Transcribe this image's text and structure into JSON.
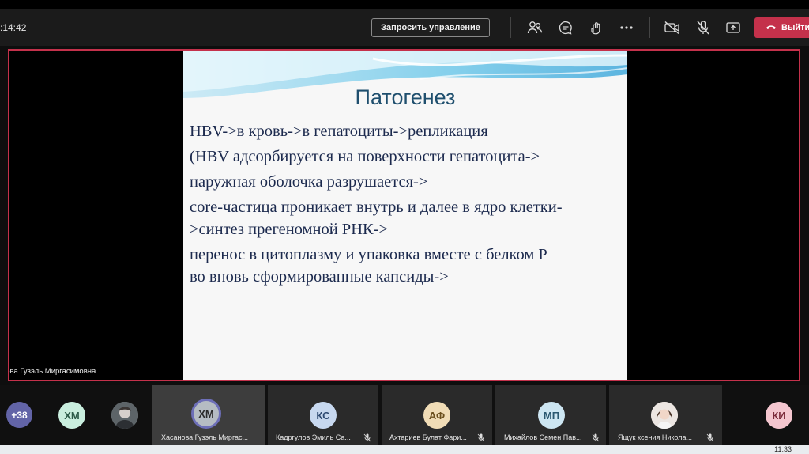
{
  "meeting": {
    "timer": ":14:42",
    "request_control_label": "Запросить управление",
    "leave_label": "Выйти",
    "presenter_name": "нова Гузэль Миргасимовна"
  },
  "slide": {
    "title": "Патогенез",
    "lines": [
      "HBV->в кровь->в гепатоциты->репликация",
      "(HBV адсорбируется на поверхности гепатоцита->",
      "наружная оболочка разрушается->",
      "core-частица проникает внутрь и далее в ядро клетки-",
      ">синтез прегеномной РНК->",
      "перенос в цитоплазму и упаковка вместе с белком Р",
      "во вновь сформированные капсиды->"
    ]
  },
  "participants": {
    "overflow_count": "+38",
    "tiles": [
      {
        "initials": "ХМ",
        "color": "#c9eede",
        "name": ""
      },
      {
        "initials": "",
        "color": "#9aa3a8",
        "name": "",
        "is_photo": true
      },
      {
        "initials": "ХМ",
        "color": "#b5bcc3",
        "name": "Хасанова Гузэль Миргас...",
        "active": true
      },
      {
        "initials": "КС",
        "color": "#c7d8ef",
        "name": "Кадргулов Эмиль Са..."
      },
      {
        "initials": "АФ",
        "color": "#f0dcb6",
        "name": "Ахтариев Булат Фари..."
      },
      {
        "initials": "МП",
        "color": "#cde6f2",
        "name": "Михайлов Семен Пав..."
      },
      {
        "initials": "",
        "color": "#e0d4cc",
        "name": "Ящук ксения Никола...",
        "is_photo": true
      },
      {
        "initials": "КИ",
        "color": "#f4c6cf",
        "name": ""
      }
    ]
  },
  "taskbar": {
    "clock": "11:33"
  }
}
